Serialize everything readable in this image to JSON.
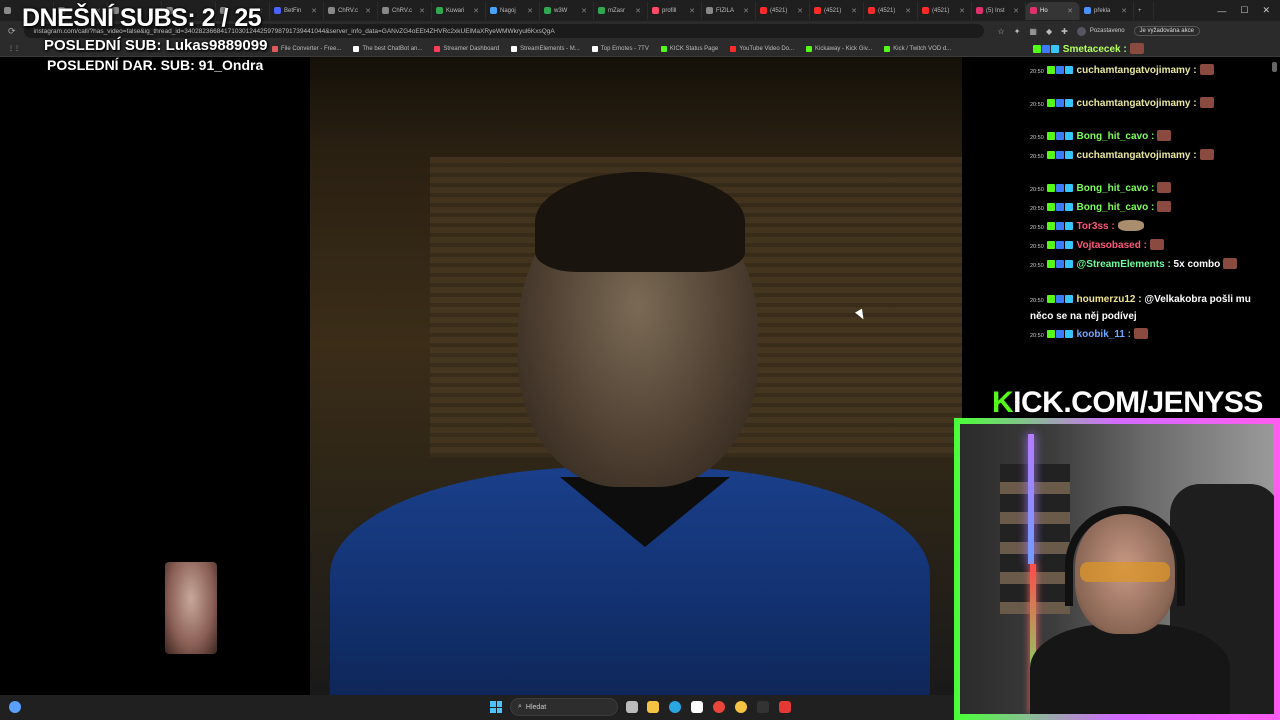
{
  "browser": {
    "tabs": [
      {
        "label": "",
        "color": "#8a8a8a"
      },
      {
        "label": "",
        "color": "#8a8a8a"
      },
      {
        "label": "",
        "color": "#8a8a8a"
      },
      {
        "label": "",
        "color": "#8a8a8a"
      },
      {
        "label": "",
        "color": "#8a8a8a"
      },
      {
        "label": "BetFin",
        "color": "#4a63ff"
      },
      {
        "label": "ChRV.c",
        "color": "#888888"
      },
      {
        "label": "ChRV.c",
        "color": "#888888"
      },
      {
        "label": "Kuwari",
        "color": "#2fa84f"
      },
      {
        "label": "Nagoj",
        "color": "#4aa3ff"
      },
      {
        "label": "w3W",
        "color": "#2fa84f"
      },
      {
        "label": "mZasr",
        "color": "#2fa84f"
      },
      {
        "label": "profill",
        "color": "#ff4a6a"
      },
      {
        "label": "FIZILA",
        "color": "#888888"
      },
      {
        "label": "(4521)",
        "color": "#ff2a2a"
      },
      {
        "label": "(4521)",
        "color": "#ff2a2a"
      },
      {
        "label": "(4521)",
        "color": "#ff2a2a"
      },
      {
        "label": "(4521)",
        "color": "#ff2a2a"
      },
      {
        "label": "(5) Inst",
        "color": "#e1306c"
      },
      {
        "label": "Ho",
        "color": "#e1306c"
      },
      {
        "label": "překla",
        "color": "#4a90ff"
      }
    ],
    "url": "instagram.com/call/?has_video=false&ig_thread_id=340282366841710301244259798791739441044&server_info_data=GANvZG4oEEt4ZHVRc2xkUElMaXRyeWMWkryul6KxsQgA",
    "profile_label": "Pozastaveno",
    "update_label": "Je vyžadována akce",
    "bookmarks": [
      {
        "label": "File Converter - Free...",
        "color": "#e05a5a"
      },
      {
        "label": "The best ChatBot an...",
        "color": "#ffffff"
      },
      {
        "label": "Streamer Dashboard",
        "color": "#ff3b5c"
      },
      {
        "label": "StreamElements - M...",
        "color": "#ffffff"
      },
      {
        "label": "Top Emotes - 7TV",
        "color": "#ffffff"
      },
      {
        "label": "KICK Status Page",
        "color": "#53fc18"
      },
      {
        "label": "YouTube Video Do...",
        "color": "#ff2a2a"
      },
      {
        "label": "Kickaway - Kick Giv...",
        "color": "#53fc18"
      },
      {
        "label": "Kick / Twitch VOD d...",
        "color": "#53fc18"
      }
    ]
  },
  "overlay": {
    "subs_counter": "DNEŠNÍ SUBS: 2 / 25",
    "last_sub": "POSLEDNÍ SUB: Lukas9889099",
    "last_gift_sub": "POSLEDNÍ DAR. SUB: 91_Ondra"
  },
  "chat": {
    "messages": [
      {
        "time": "",
        "user": "Smetacecek",
        "text": "",
        "user_color": "#b5ff5a",
        "emote": "brown"
      },
      {
        "time": "20:50",
        "user": "cuchamtangatvojimamy",
        "text": "",
        "user_color": "#e8e8a0",
        "emote": "brown"
      },
      {
        "time": "20:50",
        "user": "cuchamtangatvojimamy",
        "text": "",
        "user_color": "#e8e8a0",
        "emote": "brown"
      },
      {
        "time": "20:50",
        "user": "Bong_hit_cavo",
        "text": "",
        "user_color": "#7dff5a",
        "emote": "brown"
      },
      {
        "time": "20:50",
        "user": "cuchamtangatvojimamy",
        "text": "",
        "user_color": "#e8e8a0",
        "emote": "brown"
      },
      {
        "time": "20:50",
        "user": "Bong_hit_cavo",
        "text": "",
        "user_color": "#7dff5a",
        "emote": "brown"
      },
      {
        "time": "20:50",
        "user": "Bong_hit_cavo",
        "text": "",
        "user_color": "#7dff5a",
        "emote": "brown"
      },
      {
        "time": "20:50",
        "user": "Tor3ss",
        "text": "",
        "user_color": "#ff5a7a",
        "emote": "wide"
      },
      {
        "time": "20:50",
        "user": "Vojtasobased",
        "text": "",
        "user_color": "#ff5a7a",
        "emote": "brown"
      },
      {
        "time": "20:50",
        "user": "@StreamElements",
        "text": "5x combo",
        "user_color": "#6fff9a",
        "emote": "brown"
      },
      {
        "time": "20:50",
        "user": "houmerzu12",
        "text": "@Velkakobra pošli mu něco se na něj podívej",
        "user_color": "#f0e68c",
        "emote": ""
      },
      {
        "time": "20:50",
        "user": "koobik_11",
        "text": "",
        "user_color": "#6fa8ff",
        "emote": "brown"
      }
    ]
  },
  "kick_banner": {
    "prefix": "K",
    "rest": "ICK.COM/JENYSS"
  },
  "taskbar": {
    "search_label": "Hledat",
    "apps": [
      {
        "name": "task-view",
        "color": "#bbbbbb"
      },
      {
        "name": "file-explorer",
        "color": "#f5c343"
      },
      {
        "name": "edge",
        "color": "#2aa7e0"
      },
      {
        "name": "store",
        "color": "#ffffff"
      },
      {
        "name": "chrome",
        "color": "#e9453a"
      },
      {
        "name": "chrome-active",
        "color": "#f5c343"
      },
      {
        "name": "terminal",
        "color": "#333333"
      },
      {
        "name": "settings-app",
        "color": "#e53935"
      }
    ]
  }
}
